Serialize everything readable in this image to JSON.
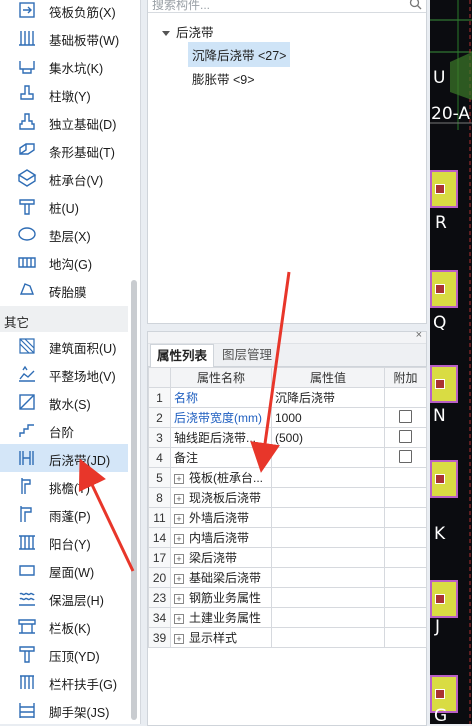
{
  "nav": {
    "items_top": [
      {
        "label": "筏板负筋(X)",
        "icon": "raft-rebar-icon"
      },
      {
        "label": "基础板带(W)",
        "icon": "foundation-strip-icon"
      },
      {
        "label": "集水坑(K)",
        "icon": "sump-pit-icon"
      },
      {
        "label": "柱墩(Y)",
        "icon": "column-pier-icon"
      },
      {
        "label": "独立基础(D)",
        "icon": "isolated-footing-icon"
      },
      {
        "label": "条形基础(T)",
        "icon": "strip-footing-icon"
      },
      {
        "label": "桩承台(V)",
        "icon": "pile-cap-icon"
      },
      {
        "label": "桩(U)",
        "icon": "pile-icon"
      },
      {
        "label": "垫层(X)",
        "icon": "cushion-icon"
      },
      {
        "label": "地沟(G)",
        "icon": "trench-icon"
      },
      {
        "label": "砖胎膜",
        "icon": "brick-mold-icon"
      }
    ],
    "group_label": "其它",
    "items_bottom": [
      {
        "label": "建筑面积(U)",
        "icon": "building-area-icon"
      },
      {
        "label": "平整场地(V)",
        "icon": "site-leveling-icon"
      },
      {
        "label": "散水(S)",
        "icon": "apron-icon"
      },
      {
        "label": "台阶",
        "icon": "steps-icon"
      },
      {
        "label": "后浇带(JD)",
        "icon": "post-cast-strip-icon",
        "active": true
      },
      {
        "label": "挑檐(T)",
        "icon": "cornice-icon"
      },
      {
        "label": "雨蓬(P)",
        "icon": "canopy-icon"
      },
      {
        "label": "阳台(Y)",
        "icon": "balcony-icon"
      },
      {
        "label": "屋面(W)",
        "icon": "roof-icon"
      },
      {
        "label": "保温层(H)",
        "icon": "insulation-icon"
      },
      {
        "label": "栏板(K)",
        "icon": "parapet-icon"
      },
      {
        "label": "压顶(YD)",
        "icon": "coping-icon"
      },
      {
        "label": "栏杆扶手(G)",
        "icon": "railing-icon"
      },
      {
        "label": "脚手架(JS)",
        "icon": "scaffold-icon"
      }
    ]
  },
  "tree": {
    "search_placeholder": "搜索构件...",
    "root": "后浇带",
    "children": [
      "沉降后浇带 <27>",
      "膨胀带 <9>"
    ]
  },
  "props": {
    "close": "×",
    "tabs": [
      "属性列表",
      "图层管理"
    ],
    "headers": [
      "属性名称",
      "属性值",
      "附加"
    ],
    "rows": [
      {
        "num": "1",
        "name": "名称",
        "value": "沉降后浇带",
        "blue": true
      },
      {
        "num": "2",
        "name": "后浇带宽度(mm)",
        "value": "1000",
        "blue": true,
        "check": true
      },
      {
        "num": "3",
        "name": "轴线距后浇带...",
        "value": "(500)",
        "check": true
      },
      {
        "num": "4",
        "name": "备注",
        "value": "",
        "check": true
      },
      {
        "num": "5",
        "name": "筏板(桩承台...",
        "group": true
      },
      {
        "num": "8",
        "name": "现浇板后浇带",
        "group": true
      },
      {
        "num": "11",
        "name": "外墙后浇带",
        "group": true
      },
      {
        "num": "14",
        "name": "内墙后浇带",
        "group": true
      },
      {
        "num": "17",
        "name": "梁后浇带",
        "group": true
      },
      {
        "num": "20",
        "name": "基础梁后浇带",
        "group": true
      },
      {
        "num": "23",
        "name": "钢筋业务属性",
        "group": true
      },
      {
        "num": "34",
        "name": "土建业务属性",
        "group": true
      },
      {
        "num": "39",
        "name": "显示样式",
        "group": true
      }
    ]
  },
  "cad": {
    "labels": [
      "U",
      "20-A",
      "R",
      "Q",
      "N",
      "K",
      "J",
      "G"
    ]
  },
  "colors": {
    "arrow": "#e8362a",
    "active": "#d4e6f8",
    "link": "#1f5fc0"
  }
}
